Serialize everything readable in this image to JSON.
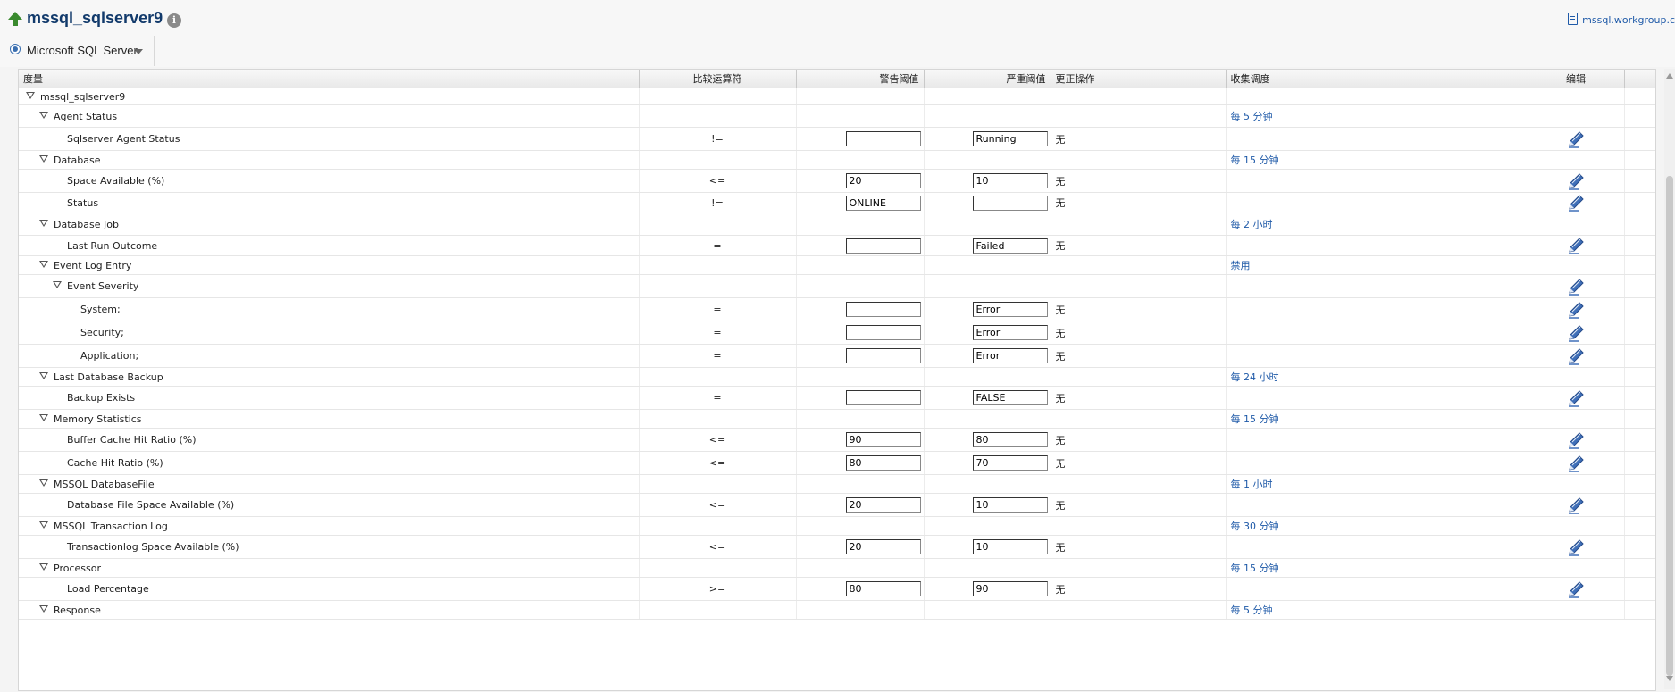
{
  "header": {
    "title": "mssql_sqlserver9",
    "host_link": "mssql.workgroup.c"
  },
  "target": {
    "label": "Microsoft SQL Server"
  },
  "columns": {
    "metric": "度量",
    "op": "比较运算符",
    "warn": "警告阈值",
    "crit": "严重阈值",
    "action": "更正操作",
    "schedule": "收集调度",
    "edit": "编辑"
  },
  "rows": [
    {
      "level": 0,
      "group": true,
      "metric": "mssql_sqlserver9",
      "op": "",
      "warn": null,
      "crit": null,
      "action": "",
      "schedule": "",
      "edit": false
    },
    {
      "level": 1,
      "group": true,
      "metric": "Agent Status",
      "op": "",
      "warn": null,
      "crit": null,
      "action": "",
      "schedule": "每 5 分钟",
      "edit": false
    },
    {
      "level": 2,
      "group": false,
      "metric": "Sqlserver Agent Status",
      "op": "!=",
      "warn": "",
      "crit": "Running",
      "action": "无",
      "schedule": "",
      "edit": true
    },
    {
      "level": 1,
      "group": true,
      "metric": "Database",
      "op": "",
      "warn": null,
      "crit": null,
      "action": "",
      "schedule": "每 15 分钟",
      "edit": false
    },
    {
      "level": 2,
      "group": false,
      "metric": "Space Available (%)",
      "op": "<=",
      "warn": "20",
      "crit": "10",
      "action": "无",
      "schedule": "",
      "edit": true
    },
    {
      "level": 2,
      "group": false,
      "metric": "Status",
      "op": "!=",
      "warn": "ONLINE",
      "crit": "",
      "action": "无",
      "schedule": "",
      "edit": true
    },
    {
      "level": 1,
      "group": true,
      "metric": "Database Job",
      "op": "",
      "warn": null,
      "crit": null,
      "action": "",
      "schedule": "每 2 小时",
      "edit": false
    },
    {
      "level": 2,
      "group": false,
      "metric": "Last Run Outcome",
      "op": "=",
      "warn": "",
      "crit": "Failed",
      "action": "无",
      "schedule": "",
      "edit": true
    },
    {
      "level": 1,
      "group": true,
      "metric": "Event Log Entry",
      "op": "",
      "warn": null,
      "crit": null,
      "action": "",
      "schedule": "禁用",
      "edit": false
    },
    {
      "level": 2,
      "group": true,
      "metric": "Event Severity",
      "op": "",
      "warn": null,
      "crit": null,
      "action": "",
      "schedule": "",
      "edit": true
    },
    {
      "level": 3,
      "group": false,
      "metric": "System;",
      "op": "=",
      "warn": "",
      "crit": "Error",
      "action": "无",
      "schedule": "",
      "edit": true
    },
    {
      "level": 3,
      "group": false,
      "metric": "Security;",
      "op": "=",
      "warn": "",
      "crit": "Error",
      "action": "无",
      "schedule": "",
      "edit": true
    },
    {
      "level": 3,
      "group": false,
      "metric": "Application;",
      "op": "=",
      "warn": "",
      "crit": "Error",
      "action": "无",
      "schedule": "",
      "edit": true
    },
    {
      "level": 1,
      "group": true,
      "metric": "Last Database Backup",
      "op": "",
      "warn": null,
      "crit": null,
      "action": "",
      "schedule": "每 24 小时",
      "edit": false
    },
    {
      "level": 2,
      "group": false,
      "metric": "Backup Exists",
      "op": "=",
      "warn": "",
      "crit": "FALSE",
      "action": "无",
      "schedule": "",
      "edit": true
    },
    {
      "level": 1,
      "group": true,
      "metric": "Memory Statistics",
      "op": "",
      "warn": null,
      "crit": null,
      "action": "",
      "schedule": "每 15 分钟",
      "edit": false
    },
    {
      "level": 2,
      "group": false,
      "metric": "Buffer Cache Hit Ratio (%)",
      "op": "<=",
      "warn": "90",
      "crit": "80",
      "action": "无",
      "schedule": "",
      "edit": true
    },
    {
      "level": 2,
      "group": false,
      "metric": "Cache Hit Ratio (%)",
      "op": "<=",
      "warn": "80",
      "crit": "70",
      "action": "无",
      "schedule": "",
      "edit": true
    },
    {
      "level": 1,
      "group": true,
      "metric": "MSSQL DatabaseFile",
      "op": "",
      "warn": null,
      "crit": null,
      "action": "",
      "schedule": "每 1 小时",
      "edit": false
    },
    {
      "level": 2,
      "group": false,
      "metric": "Database File Space Available (%)",
      "op": "<=",
      "warn": "20",
      "crit": "10",
      "action": "无",
      "schedule": "",
      "edit": true
    },
    {
      "level": 1,
      "group": true,
      "metric": "MSSQL Transaction Log",
      "op": "",
      "warn": null,
      "crit": null,
      "action": "",
      "schedule": "每 30 分钟",
      "edit": false
    },
    {
      "level": 2,
      "group": false,
      "metric": "Transactionlog Space Available (%)",
      "op": "<=",
      "warn": "20",
      "crit": "10",
      "action": "无",
      "schedule": "",
      "edit": true
    },
    {
      "level": 1,
      "group": true,
      "metric": "Processor",
      "op": "",
      "warn": null,
      "crit": null,
      "action": "",
      "schedule": "每 15 分钟",
      "edit": false
    },
    {
      "level": 2,
      "group": false,
      "metric": "Load Percentage",
      "op": ">=",
      "warn": "80",
      "crit": "90",
      "action": "无",
      "schedule": "",
      "edit": true
    },
    {
      "level": 1,
      "group": true,
      "metric": "Response",
      "op": "",
      "warn": null,
      "crit": null,
      "action": "",
      "schedule": "每 5 分钟",
      "edit": false
    }
  ]
}
